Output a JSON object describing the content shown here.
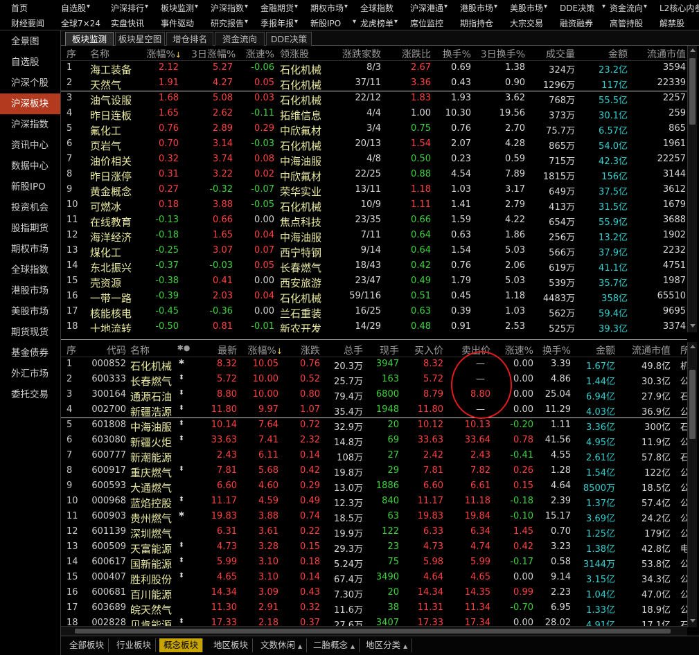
{
  "menu": {
    "row1": [
      "首页",
      "自选股",
      "沪深排行",
      "板块监测",
      "沪深指数",
      "金融期货",
      "期权市场",
      "全球指数",
      "沪深港通",
      "港股市场",
      "美股市场",
      "DDE决策",
      "资金流向",
      "L2核心内参"
    ],
    "row2": [
      "财经要闻",
      "全球7×24",
      "实盘快讯",
      "事件驱动",
      "研究报告",
      "季报年报",
      "新股IPO",
      "龙虎榜单",
      "席位监控",
      "期指持仓",
      "大宗交易",
      "融资融券",
      "高管持股",
      "解禁股"
    ]
  },
  "sidebar": [
    "全景图",
    "自选股",
    "沪深个股",
    "沪深板块",
    "沪深指数",
    "资讯中心",
    "数据中心",
    "新股IPO",
    "投资机会",
    "股指期货",
    "期权市场",
    "全球指数",
    "港股市场",
    "美股市场",
    "期货现货",
    "基金债券",
    "外汇市场",
    "委托交易"
  ],
  "sidebar_active": 3,
  "top_tabs": [
    "板块监测",
    "板块星空图",
    "增仓排名",
    "资金流向",
    "DDE决策"
  ],
  "top_active": 0,
  "sector_headers": [
    "序",
    "名称",
    "涨幅%",
    "3日涨幅%",
    "涨速%",
    "领涨股",
    "涨跌家数",
    "涨跌比",
    "换手%",
    "3日换手%",
    "成交量",
    "金额",
    "流通市值"
  ],
  "sector_sort_mark": "↓",
  "sectors": [
    [
      "1",
      "海工装备",
      "2.12",
      "5.27",
      "-0.06",
      "石化机械",
      "8/3",
      "2.67",
      "0.69",
      "1.38",
      "324万",
      "23.2亿",
      "3594"
    ],
    [
      "2",
      "天然气",
      "1.91",
      "4.27",
      "0.05",
      "石化机械",
      "37/11",
      "3.36",
      "0.43",
      "0.90",
      "1296万",
      "117亿",
      "22339"
    ],
    [
      "3",
      "油气设服",
      "1.68",
      "5.08",
      "0.03",
      "石化机械",
      "22/12",
      "1.83",
      "1.93",
      "3.62",
      "768万",
      "55.5亿",
      "2257"
    ],
    [
      "4",
      "昨日连板",
      "1.65",
      "2.62",
      "-0.11",
      "拓维信息",
      "4/4",
      "1.00",
      "10.30",
      "19.56",
      "373万",
      "30.1亿",
      "259"
    ],
    [
      "5",
      "氟化工",
      "0.76",
      "2.89",
      "0.29",
      "中欣氟材",
      "3/4",
      "0.75",
      "0.76",
      "2.70",
      "75.7万",
      "6.57亿",
      "865"
    ],
    [
      "6",
      "页岩气",
      "0.70",
      "3.14",
      "-0.03",
      "石化机械",
      "20/13",
      "1.54",
      "2.07",
      "4.28",
      "865万",
      "54.0亿",
      "1961"
    ],
    [
      "7",
      "油价相关",
      "0.32",
      "3.74",
      "0.08",
      "中海油服",
      "4/8",
      "0.50",
      "0.23",
      "0.59",
      "715万",
      "42.3亿",
      "22257"
    ],
    [
      "8",
      "昨日涨停",
      "0.31",
      "3.22",
      "0.02",
      "中欣氟材",
      "22/25",
      "0.88",
      "4.54",
      "7.89",
      "1815万",
      "156亿",
      "3144"
    ],
    [
      "9",
      "黄金概念",
      "0.27",
      "-0.32",
      "-0.07",
      "荣华实业",
      "13/11",
      "1.18",
      "1.03",
      "3.17",
      "649万",
      "37.5亿",
      "3612"
    ],
    [
      "10",
      "可燃冰",
      "0.18",
      "3.88",
      "-0.05",
      "石化机械",
      "10/9",
      "1.11",
      "1.41",
      "2.79",
      "413万",
      "31.5亿",
      "1679"
    ],
    [
      "11",
      "在线教育",
      "-0.13",
      "0.66",
      "0.00",
      "焦点科技",
      "23/35",
      "0.66",
      "1.59",
      "4.22",
      "654万",
      "55.9亿",
      "3688"
    ],
    [
      "12",
      "海洋经济",
      "-0.18",
      "1.65",
      "0.04",
      "中海油服",
      "7/11",
      "0.64",
      "0.63",
      "1.86",
      "256万",
      "13.2亿",
      "1902"
    ],
    [
      "13",
      "煤化工",
      "-0.25",
      "3.07",
      "0.07",
      "西宁特钢",
      "9/14",
      "0.64",
      "1.54",
      "5.03",
      "566万",
      "37.9亿",
      "2232"
    ],
    [
      "14",
      "东北振兴",
      "-0.37",
      "-0.03",
      "0.05",
      "长春燃气",
      "18/43",
      "0.42",
      "0.76",
      "2.06",
      "619万",
      "41.1亿",
      "4751"
    ],
    [
      "15",
      "壳资源",
      "-0.38",
      "0.41",
      "0.00",
      "西安旅游",
      "23/47",
      "0.49",
      "1.79",
      "5.03",
      "539万",
      "35.7亿",
      "1987"
    ],
    [
      "16",
      "一带一路",
      "-0.39",
      "2.03",
      "0.04",
      "石化机械",
      "59/116",
      "0.51",
      "0.45",
      "1.18",
      "4483万",
      "358亿",
      "65510"
    ],
    [
      "17",
      "核能核电",
      "-0.45",
      "-0.36",
      "0.00",
      "兰石重装",
      "16/25",
      "0.63",
      "0.39",
      "1.03",
      "562万",
      "59.4亿",
      "9695"
    ],
    [
      "18",
      "十地流转",
      "-0.50",
      "0.81",
      "-0.01",
      "新农开发",
      "14/29",
      "0.48",
      "0.91",
      "2.53",
      "525万",
      "39.3亿",
      "3374"
    ]
  ],
  "stock_headers": [
    "序",
    "代码",
    "名称",
    "",
    "最新",
    "涨幅%",
    "涨跌",
    "总手",
    "现手",
    "买入价",
    "卖出价",
    "涨速%",
    "换手%",
    "金额",
    "流通市值",
    "所"
  ],
  "stock_name_marks": "✱●",
  "stocks": [
    [
      "1",
      "000852",
      "石化机械",
      "✱",
      "8.32",
      "10.05",
      "0.76",
      "20.3万",
      "3947",
      "8.32",
      "—",
      "0.00",
      "3.39",
      "1.67亿",
      "49.8亿",
      "机"
    ],
    [
      "2",
      "600333",
      "长春燃气",
      "⬍",
      "5.72",
      "10.00",
      "0.52",
      "25.7万",
      "163",
      "5.72",
      "—",
      "0.00",
      "4.86",
      "1.44亿",
      "30.3亿",
      "公"
    ],
    [
      "3",
      "300164",
      "通源石油",
      "⬍",
      "8.80",
      "10.00",
      "0.80",
      "79.4万",
      "6800",
      "8.79",
      "8.80",
      "0.00",
      "25.04",
      "6.94亿",
      "27.9亿",
      "石"
    ],
    [
      "4",
      "002700",
      "新疆浩源",
      "⬍",
      "11.80",
      "9.97",
      "1.07",
      "35.4万",
      "1948",
      "11.80",
      "—",
      "0.00",
      "11.29",
      "4.03亿",
      "36.9亿",
      "公"
    ],
    [
      "5",
      "601808",
      "中海油服",
      "⬍",
      "10.14",
      "7.64",
      "0.72",
      "32.9万",
      "20",
      "10.12",
      "10.13",
      "-0.20",
      "1.11",
      "3.36亿",
      "300亿",
      "石"
    ],
    [
      "6",
      "603080",
      "新疆火炬",
      "⬍",
      "33.63",
      "7.41",
      "2.32",
      "14.8万",
      "69",
      "33.63",
      "33.64",
      "0.78",
      "41.56",
      "4.95亿",
      "11.9亿",
      "公"
    ],
    [
      "7",
      "600777",
      "新潮能源",
      "",
      "2.43",
      "6.11",
      "0.14",
      "108万",
      "27",
      "2.42",
      "2.43",
      "-0.41",
      "4.55",
      "2.61亿",
      "57.8亿",
      "石"
    ],
    [
      "8",
      "600917",
      "重庆燃气",
      "⬍",
      "7.81",
      "5.68",
      "0.42",
      "19.8万",
      "29",
      "7.81",
      "7.82",
      "0.26",
      "1.28",
      "1.54亿",
      "122亿",
      "公"
    ],
    [
      "9",
      "600593",
      "大通燃气",
      "",
      "6.60",
      "4.60",
      "0.29",
      "13.0万",
      "1886",
      "6.60",
      "6.61",
      "0.15",
      "4.64",
      "8500万",
      "18.5亿",
      "公"
    ],
    [
      "10",
      "000968",
      "蓝焰控股",
      "⬍",
      "11.17",
      "4.59",
      "0.49",
      "12.3万",
      "840",
      "11.17",
      "11.18",
      "-0.18",
      "2.39",
      "1.37亿",
      "57.4亿",
      "公"
    ],
    [
      "11",
      "600903",
      "贵州燃气",
      "✱",
      "19.83",
      "3.88",
      "0.74",
      "18.5万",
      "63",
      "19.83",
      "19.84",
      "-0.10",
      "15.17",
      "3.69亿",
      "24.2亿",
      "公"
    ],
    [
      "12",
      "601139",
      "深圳燃气",
      "",
      "6.31",
      "3.61",
      "0.22",
      "19.9万",
      "122",
      "6.33",
      "6.34",
      "1.45",
      "0.70",
      "1.25亿",
      "179亿",
      "公"
    ],
    [
      "13",
      "600509",
      "天富能源",
      "⬍",
      "4.73",
      "3.28",
      "0.15",
      "29.3万",
      "23",
      "4.73",
      "4.74",
      "0.42",
      "3.23",
      "1.38亿",
      "42.8亿",
      "电"
    ],
    [
      "14",
      "600617",
      "国新能源",
      "⬍",
      "5.99",
      "3.10",
      "0.18",
      "5.24万",
      "75",
      "5.98",
      "5.99",
      "-0.17",
      "0.58",
      "3144万",
      "53.8亿",
      "公"
    ],
    [
      "15",
      "000407",
      "胜利股份",
      "⬍",
      "4.65",
      "3.10",
      "0.14",
      "67.4万",
      "3490",
      "4.64",
      "4.65",
      "0.00",
      "9.14",
      "3.15亿",
      "34.3亿",
      "公"
    ],
    [
      "16",
      "600681",
      "百川能源",
      "",
      "14.34",
      "3.09",
      "0.43",
      "7.30万",
      "20",
      "14.34",
      "14.35",
      "0.99",
      "2.23",
      "1.04亿",
      "47.0亿",
      "公"
    ],
    [
      "17",
      "603689",
      "皖天然气",
      "",
      "11.30",
      "2.91",
      "0.32",
      "11.6万",
      "38",
      "11.31",
      "11.34",
      "-0.70",
      "6.95",
      "1.33亿",
      "18.9亿",
      "公"
    ],
    [
      "18",
      "002828",
      "贝肯能源",
      "⬍",
      "17.33",
      "2.18",
      "0.37",
      "27.6万",
      "3407",
      "17.33",
      "17.34",
      "0.00",
      "28.02",
      "4.91亿",
      "17.1亿",
      "石"
    ]
  ],
  "bottom_tabs": [
    "全部板块",
    "行业板块",
    "概念板块",
    "地区板块",
    "文数休闲",
    "二胎概念",
    "地区分类"
  ],
  "bottom_caret": [
    "",
    "",
    "",
    "",
    "▲",
    "▲",
    "▲"
  ],
  "bottom_active": 2
}
